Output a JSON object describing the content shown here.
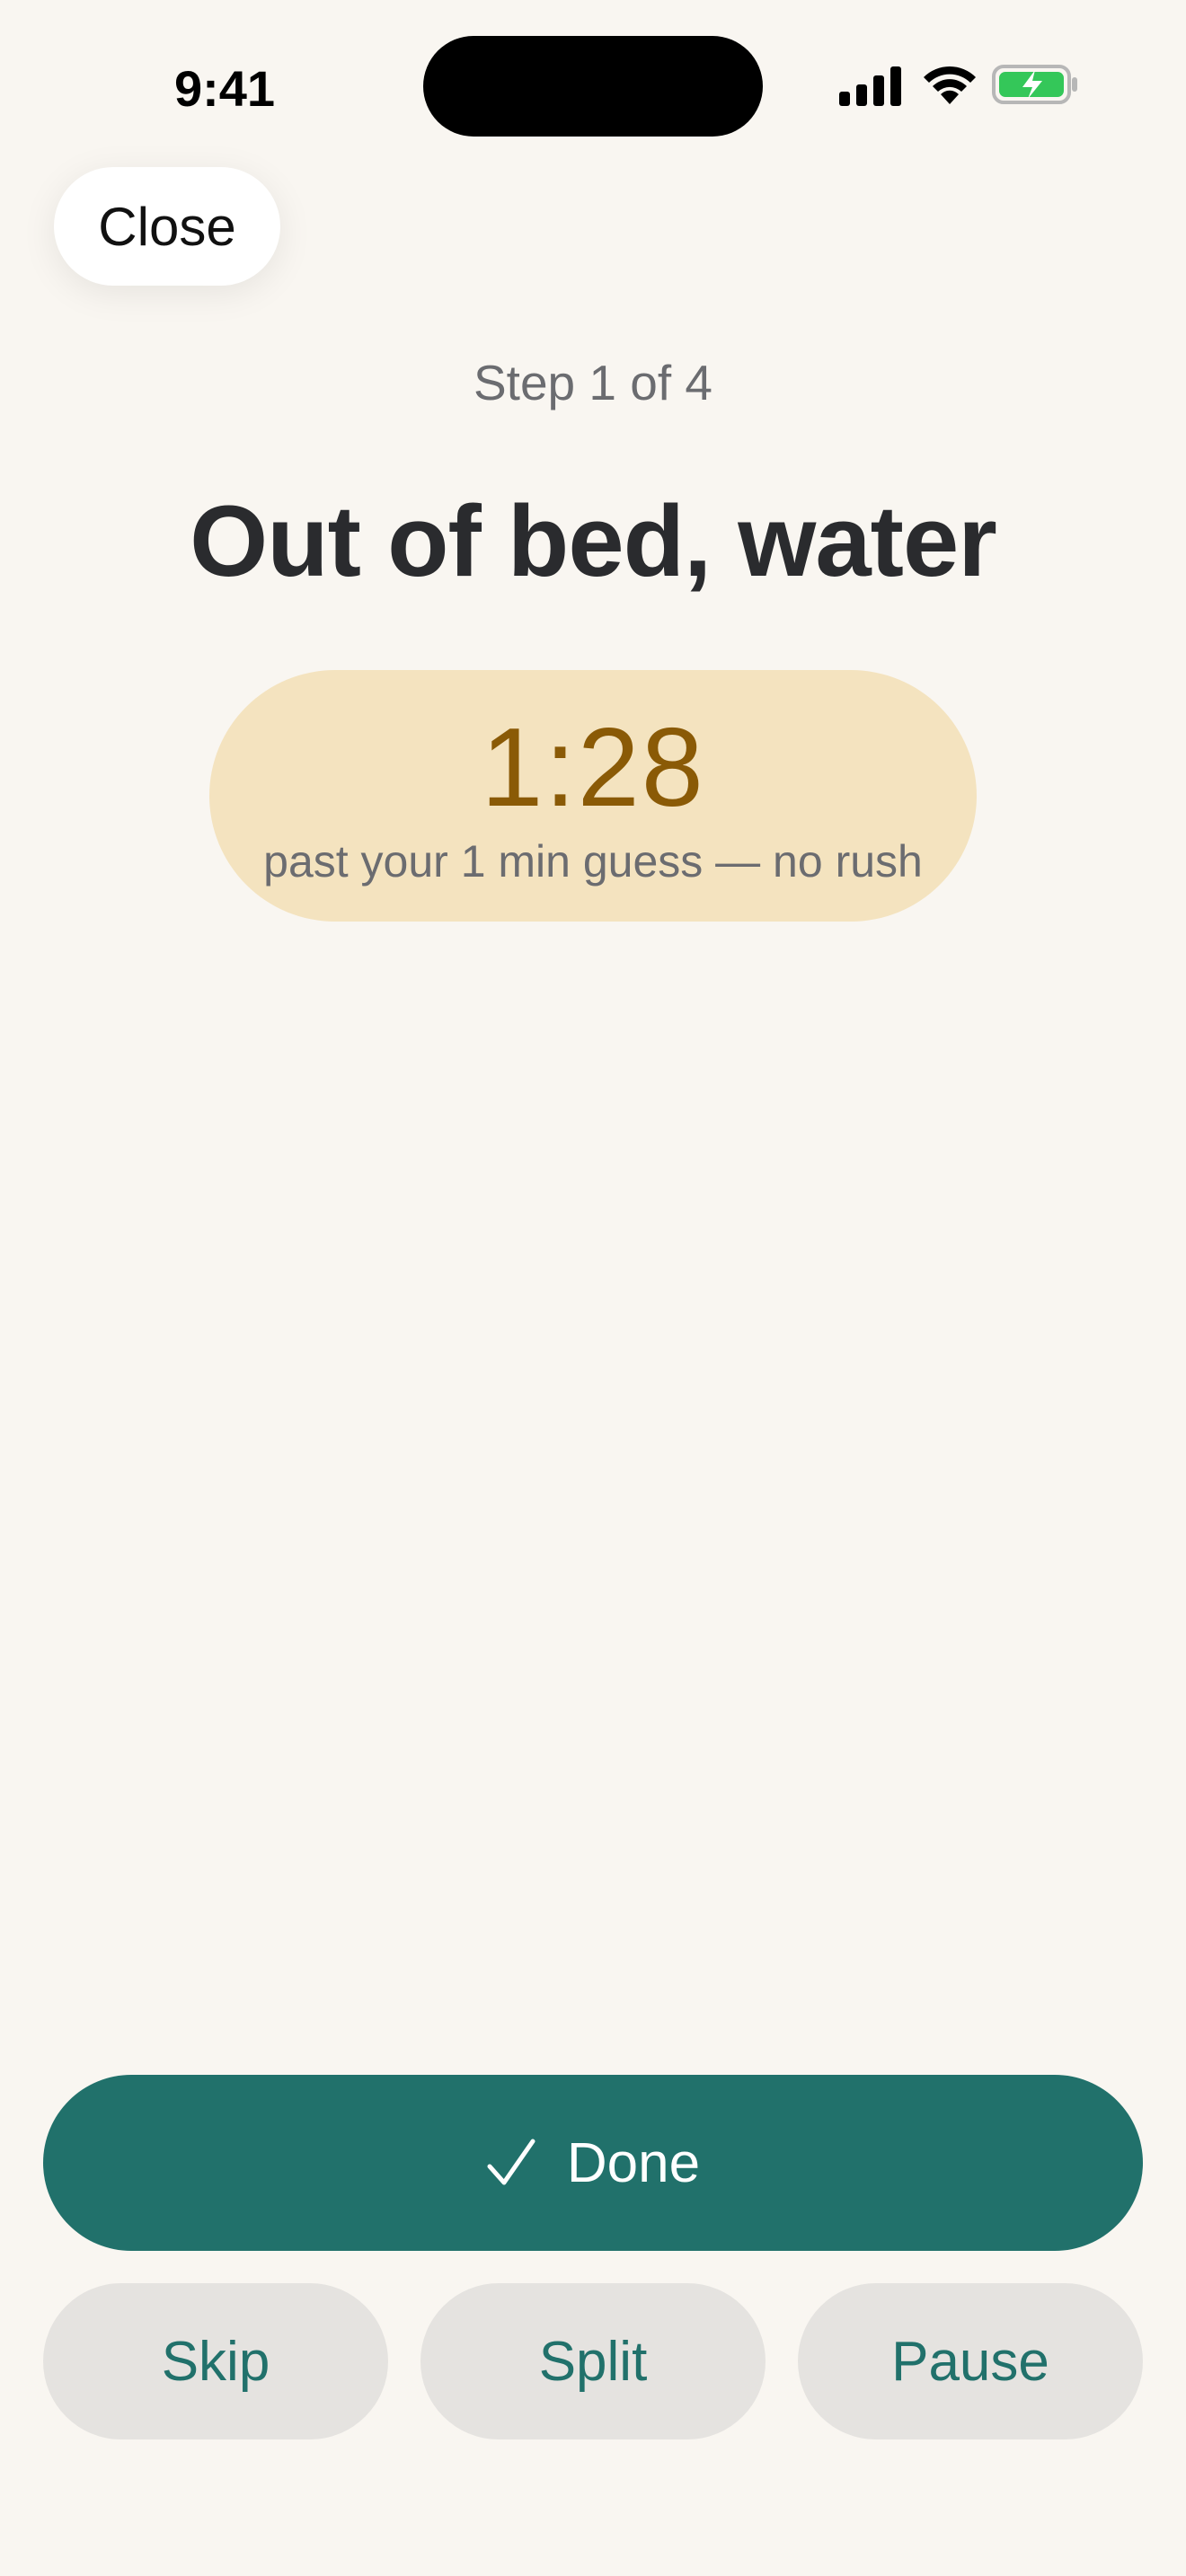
{
  "status_bar": {
    "time": "9:41",
    "icons": [
      "signal-icon",
      "wifi-icon",
      "battery-charging-icon"
    ],
    "battery_color": "#34c759"
  },
  "header": {
    "close_label": "Close"
  },
  "step": {
    "label": "Step 1 of 4",
    "title": "Out of bed, water"
  },
  "timer": {
    "elapsed": "1:28",
    "note": "past your 1 min guess — no rush",
    "pill_color": "#f4e3bf",
    "value_color": "#8a5a06"
  },
  "actions": {
    "done_label": "Done",
    "done_icon": "checkmark-icon",
    "skip_label": "Skip",
    "split_label": "Split",
    "pause_label": "Pause",
    "accent_color": "#21716b"
  }
}
